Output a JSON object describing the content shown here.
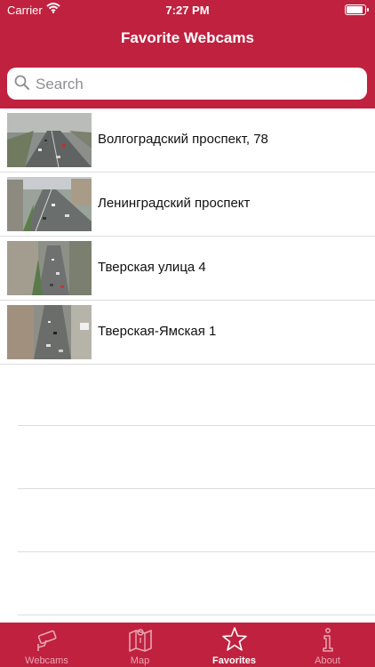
{
  "status": {
    "carrier": "Carrier",
    "time": "7:27 PM",
    "battery_level": 1.0
  },
  "nav": {
    "title": "Favorite Webcams"
  },
  "search": {
    "placeholder": "Search"
  },
  "webcams": [
    {
      "name": "Волгоградский проспект, 78",
      "thumb_icon": "traffic-camera-thumbnail"
    },
    {
      "name": "Ленинградский проспект",
      "thumb_icon": "traffic-camera-thumbnail"
    },
    {
      "name": "Тверская улица 4",
      "thumb_icon": "traffic-camera-thumbnail"
    },
    {
      "name": "Тверская-Ямская 1",
      "thumb_icon": "traffic-camera-thumbnail"
    }
  ],
  "tabs": [
    {
      "label": "Webcams",
      "icon": "webcam-icon",
      "active": false
    },
    {
      "label": "Map",
      "icon": "map-icon",
      "active": false
    },
    {
      "label": "Favorites",
      "icon": "star-icon",
      "active": true
    },
    {
      "label": "About",
      "icon": "info-icon",
      "active": false
    }
  ],
  "colors": {
    "brand": "#c0213f",
    "tab_inactive": "#e8a6b2",
    "tab_active": "#ffffff"
  }
}
